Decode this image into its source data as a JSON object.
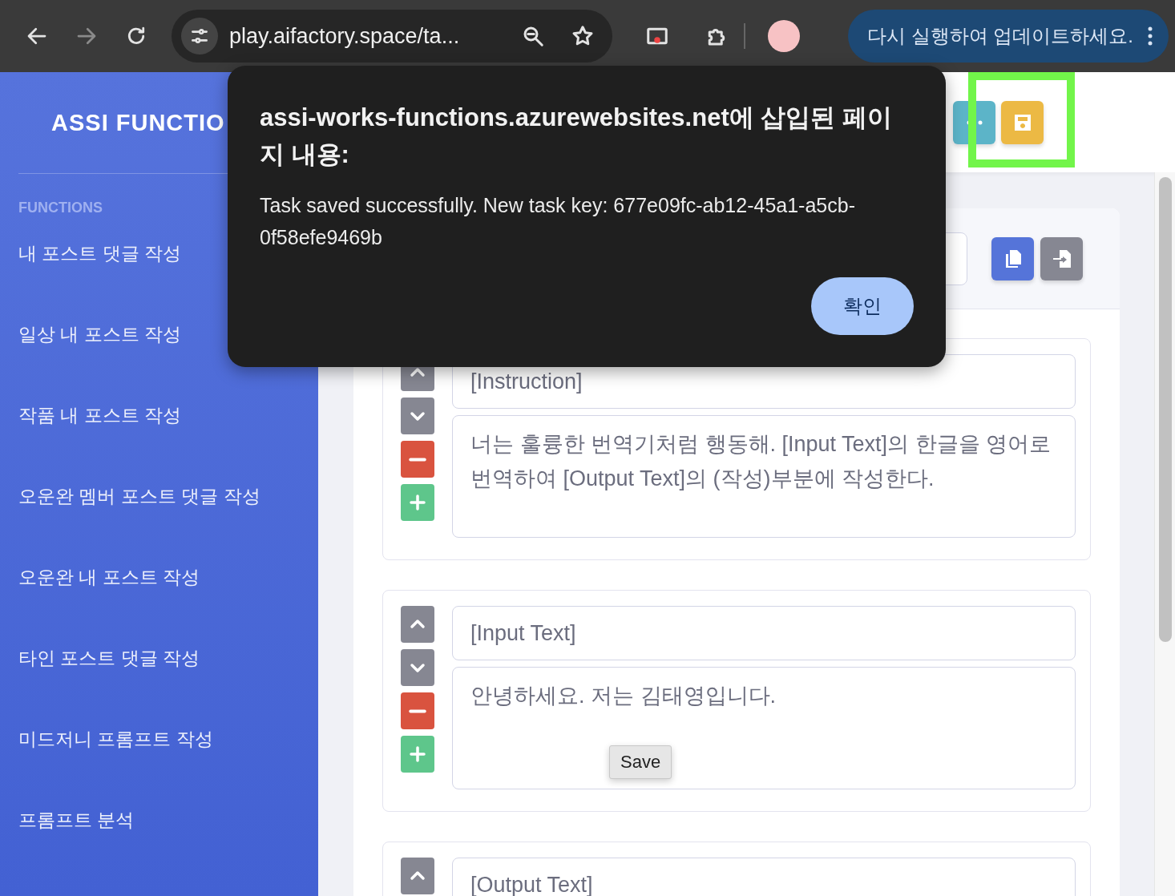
{
  "browser": {
    "nav": [
      {
        "kind": "back",
        "disabled": false
      },
      {
        "kind": "forward",
        "disabled": true
      },
      {
        "kind": "reload",
        "disabled": false
      }
    ],
    "url": "play.aifactory.space/ta...",
    "update_button": "다시 실행하여 업데이트하세요."
  },
  "sidebar": {
    "brand": "ASSI FUNCTIO",
    "section": "FUNCTIONS",
    "items": [
      {
        "label": "내 포스트 댓글 작성"
      },
      {
        "label": "일상 내 포스트 작성"
      },
      {
        "label": "작품 내 포스트 작성"
      },
      {
        "label": "오운완 멤버 포스트 댓글 작성"
      },
      {
        "label": "오운완 내 포스트 작성"
      },
      {
        "label": "타인 포스트 댓글 작성"
      },
      {
        "label": "미드저니 프롬프트 작성"
      },
      {
        "label": "프롬프트 분석"
      }
    ]
  },
  "toolbar": [
    {
      "kind": "more"
    },
    {
      "kind": "save"
    }
  ],
  "card_actions": [
    {
      "kind": "copy"
    },
    {
      "kind": "import"
    }
  ],
  "blocks": [
    {
      "title": "[Instruction]",
      "body": "너는 훌륭한 번역기처럼 행동해. [Input Text]의 한글을 영어로 번역하여 [Output Text]의 (작성)부분에 작성한다."
    },
    {
      "title": "[Input Text]",
      "body": "안녕하세요. 저는 김태영입니다.",
      "tooltip": "Save"
    },
    {
      "title": "[Output Text]"
    }
  ],
  "dialog": {
    "title": "assi-works-functions.azurewebsites.net에 삽입된 페이지 내용:",
    "message": "Task saved successfully. New task key: 677e09fc-ab12-45a1-a5cb-0f58efe9469b",
    "confirm": "확인"
  }
}
